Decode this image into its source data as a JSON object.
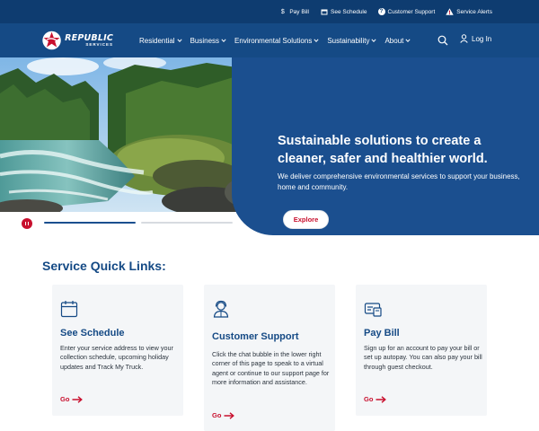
{
  "utility_bar": {
    "items": [
      {
        "label": "Pay Bill",
        "icon": "dollar-icon"
      },
      {
        "label": "See Schedule",
        "icon": "calendar-icon"
      },
      {
        "label": "Customer Support",
        "icon": "question-icon"
      },
      {
        "label": "Service Alerts",
        "icon": "alert-icon"
      }
    ]
  },
  "brand": {
    "name": "REPUBLIC",
    "sub": "SERVICES"
  },
  "nav": {
    "items": [
      {
        "label": "Residential"
      },
      {
        "label": "Business"
      },
      {
        "label": "Environmental Solutions"
      },
      {
        "label": "Sustainability"
      },
      {
        "label": "About"
      }
    ],
    "login_label": "Log In"
  },
  "hero": {
    "title": "Sustainable solutions to create a cleaner, safer and healthier world.",
    "text": "We deliver comprehensive environmental services to support your business, home and community.",
    "button_label": "Explore"
  },
  "quick_links": {
    "title": "Service Quick Links:",
    "cards": [
      {
        "icon": "calendar-icon",
        "title": "See Schedule",
        "text": "Enter your service address to view your collection schedule, upcoming holiday updates and Track My Truck.",
        "link_label": "Go"
      },
      {
        "icon": "support-agent-icon",
        "title": "Customer Support",
        "text": "Click the chat bubble in the lower right corner of this page to speak to a virtual agent or continue to our support page for more information and assistance.",
        "link_label": "Go"
      },
      {
        "icon": "bill-icon",
        "title": "Pay Bill",
        "text": "Sign up for an account to pay your bill or set up autopay. You can also pay your bill through guest checkout.",
        "link_label": "Go"
      }
    ]
  },
  "colors": {
    "utility_bg": "#0e3c70",
    "nav_bg": "#154a85",
    "hero_blue": "#1b4f8f",
    "accent_red": "#c8102e",
    "card_bg": "#f4f6f8"
  }
}
